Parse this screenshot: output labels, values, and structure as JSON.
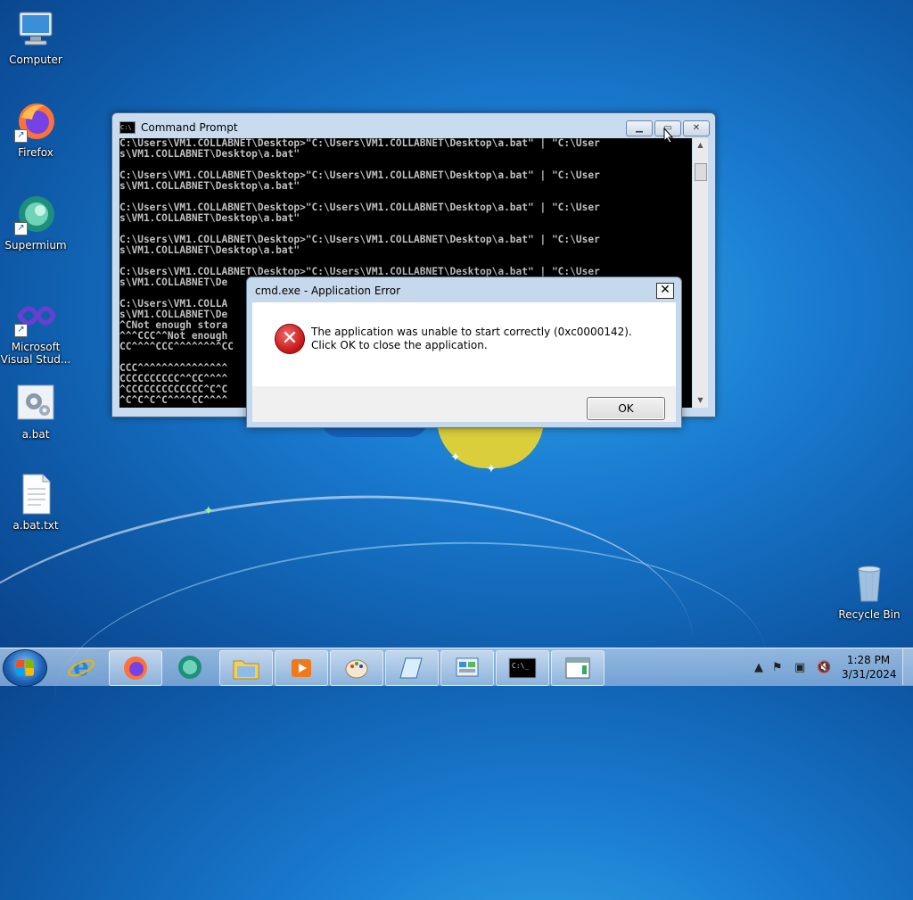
{
  "desktop": {
    "icons": [
      {
        "label": "Computer"
      },
      {
        "label": "Firefox"
      },
      {
        "label": "Supermium"
      },
      {
        "label": "Microsoft Visual Stud..."
      },
      {
        "label": "a.bat"
      },
      {
        "label": "a.bat.txt"
      },
      {
        "label": "Recycle Bin"
      }
    ]
  },
  "cmd_window": {
    "title": "Command Prompt",
    "lines": [
      "C:\\Users\\VM1.COLLABNET\\Desktop>\"C:\\Users\\VM1.COLLABNET\\Desktop\\a.bat\" | \"C:\\User",
      "s\\VM1.COLLABNET\\Desktop\\a.bat\"",
      "",
      "C:\\Users\\VM1.COLLABNET\\Desktop>\"C:\\Users\\VM1.COLLABNET\\Desktop\\a.bat\" | \"C:\\User",
      "s\\VM1.COLLABNET\\Desktop\\a.bat\"",
      "",
      "C:\\Users\\VM1.COLLABNET\\Desktop>\"C:\\Users\\VM1.COLLABNET\\Desktop\\a.bat\" | \"C:\\User",
      "s\\VM1.COLLABNET\\Desktop\\a.bat\"",
      "",
      "C:\\Users\\VM1.COLLABNET\\Desktop>\"C:\\Users\\VM1.COLLABNET\\Desktop\\a.bat\" | \"C:\\User",
      "s\\VM1.COLLABNET\\Desktop\\a.bat\"",
      "",
      "C:\\Users\\VM1.COLLABNET\\Desktop>\"C:\\Users\\VM1.COLLABNET\\Desktop\\a.bat\" | \"C:\\User",
      "s\\VM1.COLLABNET\\De",
      "",
      "C:\\Users\\VM1.COLLA",
      "s\\VM1.COLLABNET\\De",
      "^CNot enough stora",
      "^^^CCC^^Not enough",
      "CC^^^^CCC^^^^^^^^CC",
      "",
      "CCC^^^^^^^^^^^^^^^",
      "CCCCCCCCCC^^CC^^^^",
      "^CCCCCCCCCCCCC^C^C",
      "^C^C^C^C^^^^CC^^^^"
    ]
  },
  "error_dialog": {
    "title": "cmd.exe - Application Error",
    "message": "The application was unable to start correctly (0xc0000142). Click OK to close the application.",
    "ok_label": "OK"
  },
  "taskbar": {
    "clock_time": "1:28 PM",
    "clock_date": "3/31/2024"
  }
}
